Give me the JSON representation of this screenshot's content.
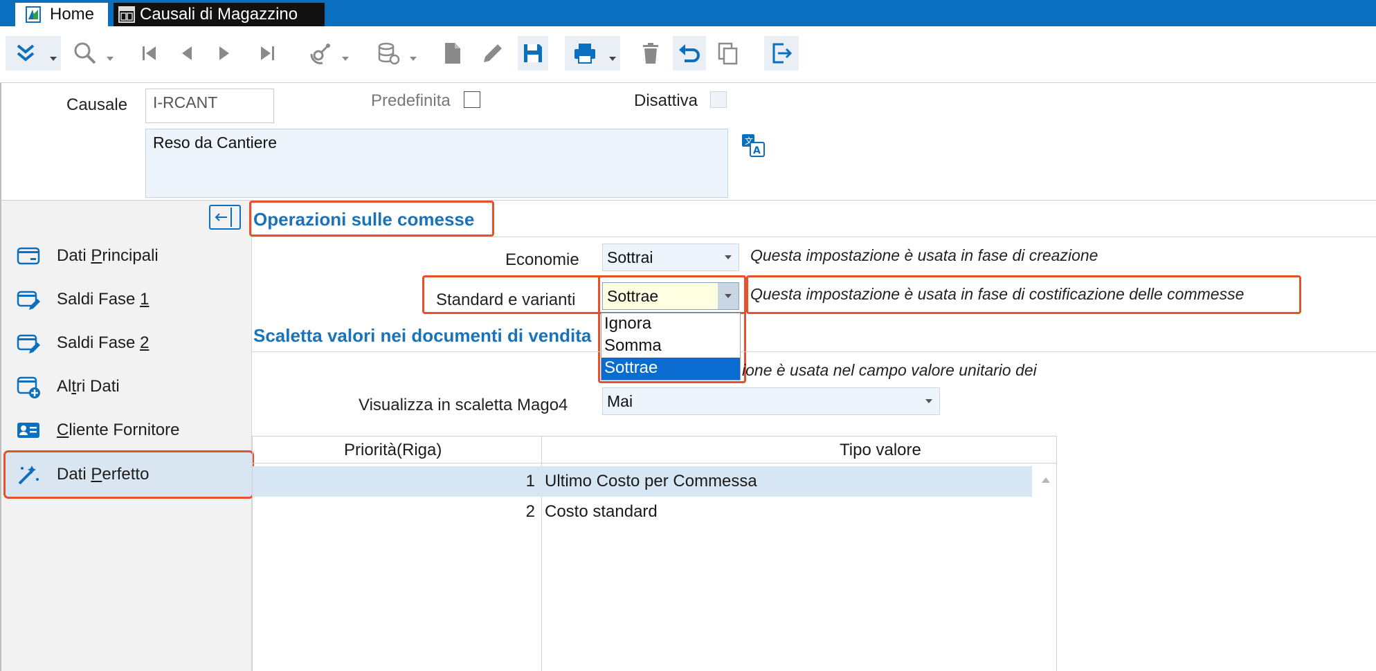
{
  "tabs": {
    "home": "Home",
    "document": "Causali di Magazzino"
  },
  "header": {
    "causale_label": "Causale",
    "causale_value": "I-RCANT",
    "predefinita_label": "Predefinita",
    "disattiva_label": "Disattiva",
    "description": "Reso da Cantiere"
  },
  "nav": {
    "items": [
      {
        "label_pre": "Dati ",
        "label_u": "P",
        "label_post": "rincipali"
      },
      {
        "label_pre": "Saldi Fase ",
        "label_u": "1",
        "label_post": ""
      },
      {
        "label_pre": "Saldi Fase ",
        "label_u": "2",
        "label_post": ""
      },
      {
        "label_pre": "Al",
        "label_u": "t",
        "label_post": "ri Dati"
      },
      {
        "label_pre": "",
        "label_u": "C",
        "label_post": "liente Fornitore"
      },
      {
        "label_pre": "Dati ",
        "label_u": "P",
        "label_post": "erfetto"
      }
    ]
  },
  "section1": {
    "title": "Operazioni sulle comesse",
    "economie_label": "Economie",
    "economie_value": "Sottrai",
    "economie_hint": "Questa impostazione è usata in fase di creazione",
    "standard_label": "Standard e varianti",
    "standard_value": "Sottrae",
    "standard_hint": "Questa impostazione è usata in fase di costificazione delle commesse",
    "dropdown_options": [
      "Ignora",
      "Somma",
      "Sottrae"
    ]
  },
  "section2": {
    "title": "Scaletta valori nei documenti di vendita",
    "hint": "ione è usata nel campo valore unitario dei",
    "visualizza_label": "Visualizza in scaletta Mago4",
    "visualizza_value": "Mai"
  },
  "grid": {
    "headers": [
      "Priorità(Riga)",
      "Tipo valore"
    ],
    "rows": [
      {
        "priority": "1",
        "type": "Ultimo Costo per Commessa"
      },
      {
        "priority": "2",
        "type": "Costo standard"
      }
    ]
  },
  "colors": {
    "accent": "#1a73b9",
    "highlight": "#e4512b",
    "titlebar": "#0b6fbf"
  }
}
